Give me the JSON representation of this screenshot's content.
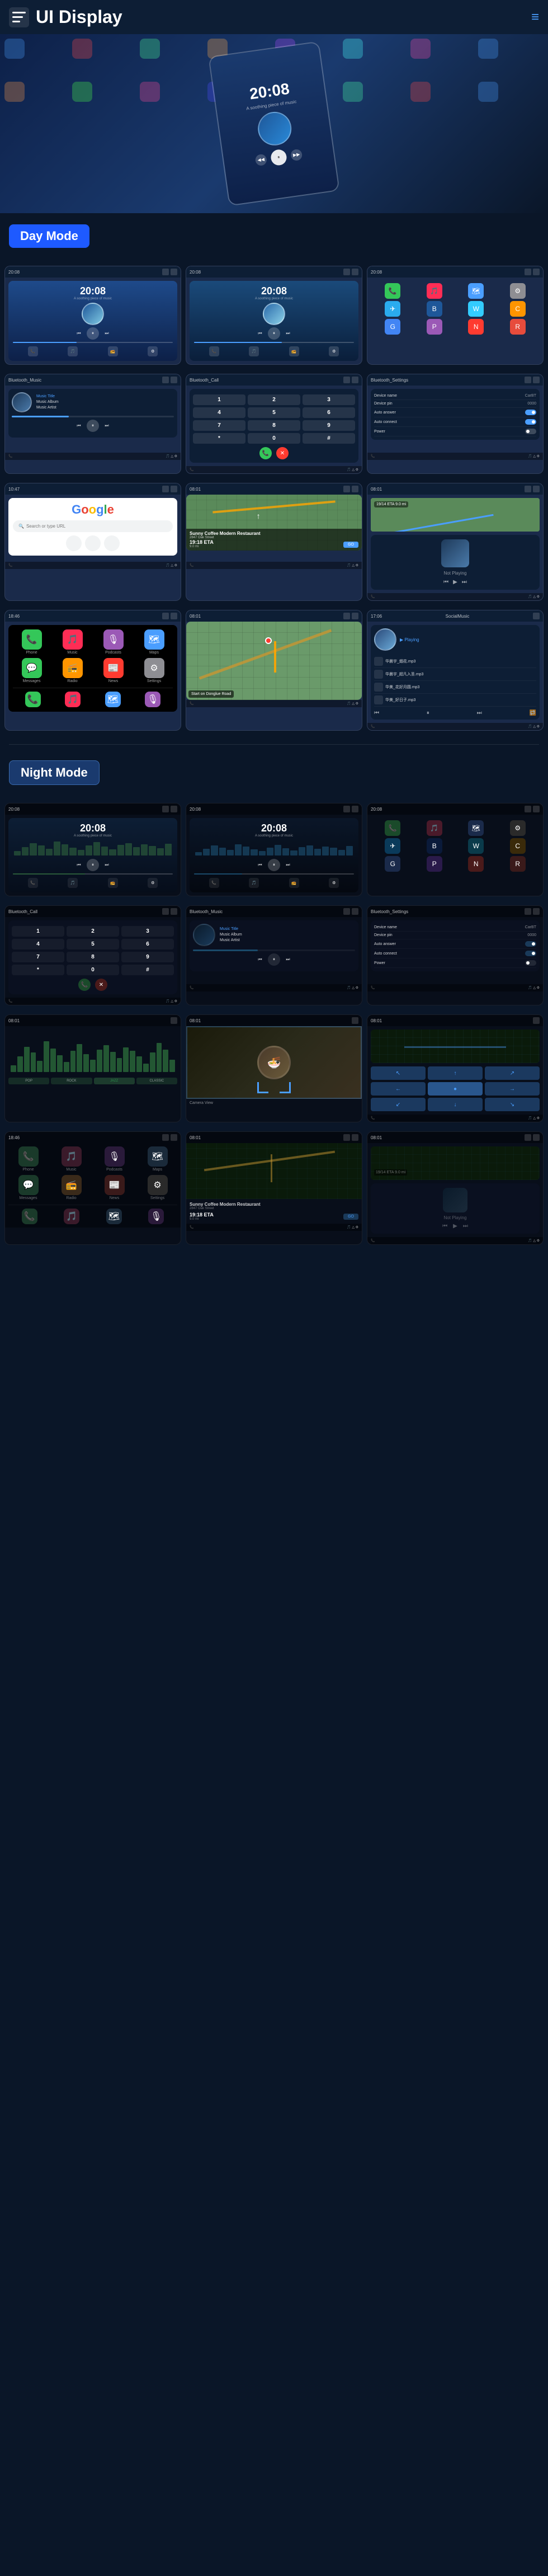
{
  "header": {
    "title": "UI Display",
    "menu_icon": "≡",
    "nav_icon": "≡"
  },
  "day_mode": {
    "label": "Day Mode"
  },
  "night_mode": {
    "label": "Night Mode"
  },
  "music": {
    "time": "20:08",
    "subtitle": "A soothing piece of music",
    "title": "Music Title",
    "album": "Music Album",
    "artist": "Music Artist"
  },
  "bt_settings": {
    "title": "Bluetooth_Settings",
    "device_name_label": "Device name",
    "device_name_val": "CarBT",
    "device_pin_label": "Device pin",
    "device_pin_val": "0000",
    "auto_answer_label": "Auto answer",
    "auto_connect_label": "Auto connect",
    "power_label": "Power"
  },
  "bt_music": {
    "title": "Bluetooth_Music",
    "music_title": "Music Title",
    "music_album": "Music Album",
    "music_artist": "Music Artist"
  },
  "bt_call": {
    "title": "Bluetooth_Call"
  },
  "nav": {
    "eta_label": "19/14 ETA",
    "eta_value": "9.0 mi",
    "destination": "Start on Donglue Road",
    "not_playing": "Not Playing"
  },
  "poi": {
    "name": "Sunny Coffee",
    "full_name": "Sunny Coffee Modern Restaurant",
    "address": "2847 Oak Street",
    "eta": "19:18 ETA",
    "distance": "9.0 mi",
    "go_label": "GO"
  },
  "app_icons": {
    "phone": "📞",
    "music": "🎵",
    "maps": "🗺️",
    "settings": "⚙️",
    "telegram": "✈️",
    "bt": "B",
    "waze": "W",
    "carplay": "C",
    "google": "G",
    "podcast": "P",
    "news": "N",
    "radio": "R"
  },
  "google": {
    "logo": "Google",
    "search_placeholder": "Search or type URL"
  },
  "waveform_heights_green": [
    8,
    15,
    22,
    18,
    12,
    25,
    20,
    14,
    10,
    18,
    24,
    16,
    11,
    19,
    22
  ],
  "waveform_heights_blue": [
    10,
    18,
    25,
    20,
    14,
    28,
    22,
    16,
    12,
    20,
    26,
    18,
    13,
    21,
    24
  ]
}
